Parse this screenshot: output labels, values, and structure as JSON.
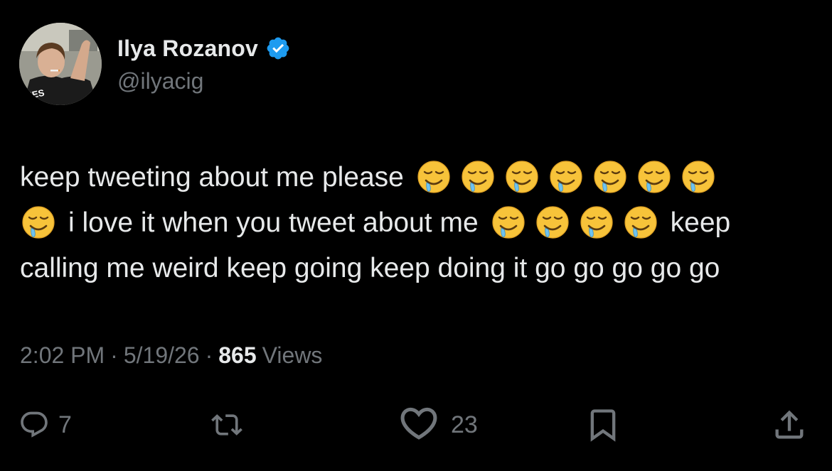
{
  "author": {
    "display_name": "Ilya Rozanov",
    "handle": "@ilyacig",
    "verified": true,
    "avatar_shirt_text": "NES"
  },
  "tweet": {
    "lines": [
      {
        "lead_emoji": 0,
        "text": "keep tweeting about me please",
        "trailing_emoji": 7
      },
      {
        "lead_emoji": 1,
        "text": "i love it when you tweet about me",
        "trailing_emoji": 4,
        "trailing_text": "keep"
      },
      {
        "lead_emoji": 0,
        "text": "calling me weird keep going keep doing it go go go go go",
        "trailing_emoji": 0
      }
    ],
    "line1": "keep tweeting about me please",
    "line2_text": "i love it when you tweet about me",
    "line2_tail": "keep",
    "line3": "calling me weird keep going keep doing it go go go go go",
    "emoji_name": "drooling-face"
  },
  "meta": {
    "time": "2:02 PM",
    "date": "5/19/26",
    "separator": "·",
    "views_count": "865",
    "views_label": "Views"
  },
  "actions": {
    "replies": "7",
    "reposts": "",
    "likes": "23"
  },
  "colors": {
    "background": "#000000",
    "text_primary": "#e7e9ea",
    "text_secondary": "#71767b",
    "verified_blue": "#1d9bf0",
    "emoji_yellow": "#f8c634"
  }
}
